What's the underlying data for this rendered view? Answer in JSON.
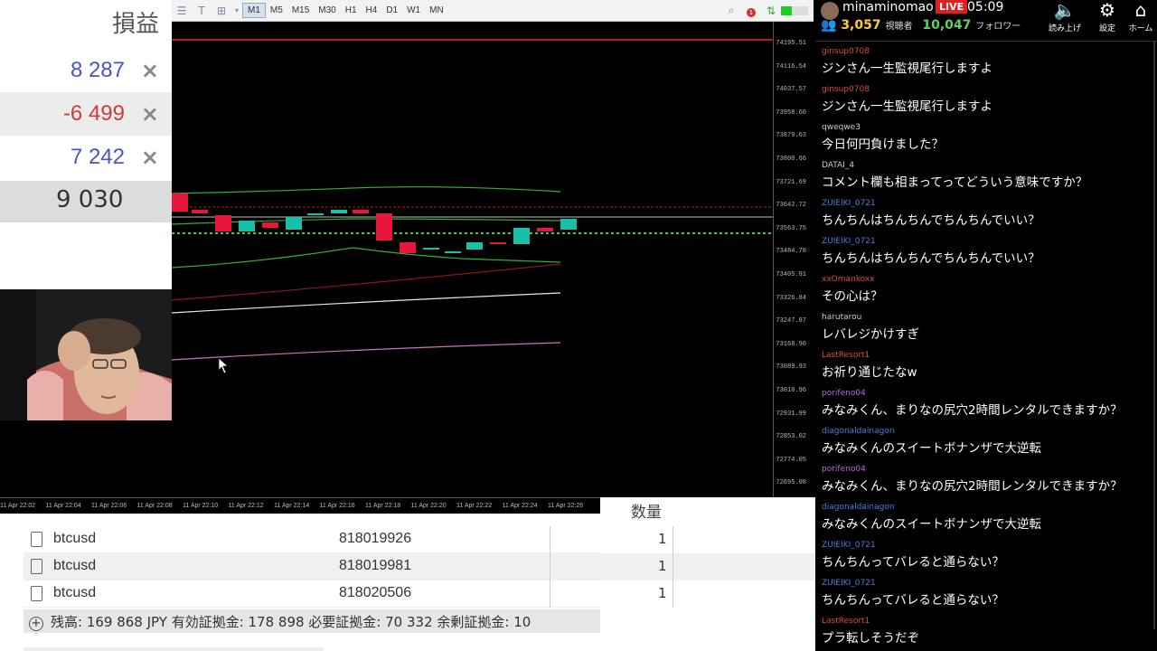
{
  "pl_panel": {
    "header": "損益",
    "rows": [
      {
        "value": "8 287",
        "sign": "positive"
      },
      {
        "value": "-6 499",
        "sign": "negative"
      },
      {
        "value": "7 242",
        "sign": "positive"
      }
    ],
    "close_icon": "×",
    "total": "9 030"
  },
  "toolbar": {
    "timeframes": [
      "M1",
      "M5",
      "M15",
      "M30",
      "H1",
      "H4",
      "D1",
      "W1",
      "MN"
    ],
    "active_timeframe": "M1",
    "notification_count": "1"
  },
  "chart": {
    "price_ticks": [
      "74195.51",
      "74116.54",
      "74037.57",
      "73958.60",
      "73879.63",
      "73800.66",
      "73721.69",
      "73642.72",
      "73563.75",
      "73484.78",
      "73405.81",
      "73326.84",
      "73247.87",
      "73168.90",
      "73089.93",
      "73010.96",
      "72931.99",
      "72853.02",
      "72774.05",
      "72695.08"
    ],
    "time_ticks": [
      "11 Apr 22:02",
      "11 Apr 22:04",
      "11 Apr 22:06",
      "11 Apr 22:08",
      "11 Apr 22:10",
      "11 Apr 22:12",
      "11 Apr 22:14",
      "11 Apr 22:16",
      "11 Apr 22:18",
      "11 Apr 22:20",
      "11 Apr 22:22",
      "11 Apr 22:24",
      "11 Apr 22:26"
    ],
    "bull_color": "#19c0a8",
    "bear_color": "#e8163c"
  },
  "positions": {
    "rows": [
      {
        "symbol": "btcusd",
        "ticket": "818019926",
        "qty": "1"
      },
      {
        "symbol": "btcusd",
        "ticket": "818019981",
        "qty": "1"
      },
      {
        "symbol": "btcusd",
        "ticket": "818020506",
        "qty": "1"
      }
    ],
    "summary": "残高: 169 868 JPY  有効証拠金: 178 898  必要証拠金: 70 332  余剰証拠金: 10",
    "qty_header": "数量"
  },
  "chat": {
    "streamer": "minaminomao",
    "live": "LIVE",
    "clock": "05:09",
    "viewers": "3,057",
    "viewers_label": "視聴者",
    "followers": "10,047",
    "followers_label": "フォロワー",
    "buttons": {
      "read": "読み上げ",
      "settings": "設定",
      "home": "ホーム"
    },
    "messages": [
      {
        "user": "ginsup0708",
        "color": "#d94a4a",
        "text": "ジンさん一生監視尾行しますよ"
      },
      {
        "user": "ginsup0708",
        "color": "#d94a4a",
        "text": "ジンさん一生監視尾行しますよ"
      },
      {
        "user": "qweqwe3",
        "color": "#cccccc",
        "text": "今日何円負けました？"
      },
      {
        "user": "DATAI_4",
        "color": "#cccccc",
        "text": "コメント欄も相まってってどういう意味ですか？"
      },
      {
        "user": "ZUIEIKI_0721",
        "color": "#4a7fd9",
        "text": "ちんちんはちんちんでちんちんでいい？"
      },
      {
        "user": "ZUIEIKI_0721",
        "color": "#4a7fd9",
        "text": "ちんちんはちんちんでちんちんでいい？"
      },
      {
        "user": "xxOmankoxx",
        "color": "#d94a4a",
        "text": "その心は？"
      },
      {
        "user": "harutarou",
        "color": "#cccccc",
        "text": "レバレジかけすぎ"
      },
      {
        "user": "LastResort1",
        "color": "#d94a4a",
        "text": "お祈り通じたなw"
      },
      {
        "user": "porifeno04",
        "color": "#b06ad9",
        "text": "みなみくん、まりなの尻穴2時間レンタルできますか？"
      },
      {
        "user": "diagonaldainagon",
        "color": "#4a7fd9",
        "text": "みなみくんのスイートボナンザで大逆転"
      },
      {
        "user": "porifeno04",
        "color": "#b06ad9",
        "text": "みなみくん、まりなの尻穴2時間レンタルできますか？"
      },
      {
        "user": "diagonaldainagon",
        "color": "#4a7fd9",
        "text": "みなみくんのスイートボナンザで大逆転"
      },
      {
        "user": "ZUIEIKI_0721",
        "color": "#4a7fd9",
        "text": "ちんちんってバレると通らない？"
      },
      {
        "user": "ZUIEIKI_0721",
        "color": "#4a7fd9",
        "text": "ちんちんってバレると通らない？"
      },
      {
        "user": "LastResort1",
        "color": "#d94a4a",
        "text": "プラ転しそうだぞ"
      }
    ]
  }
}
